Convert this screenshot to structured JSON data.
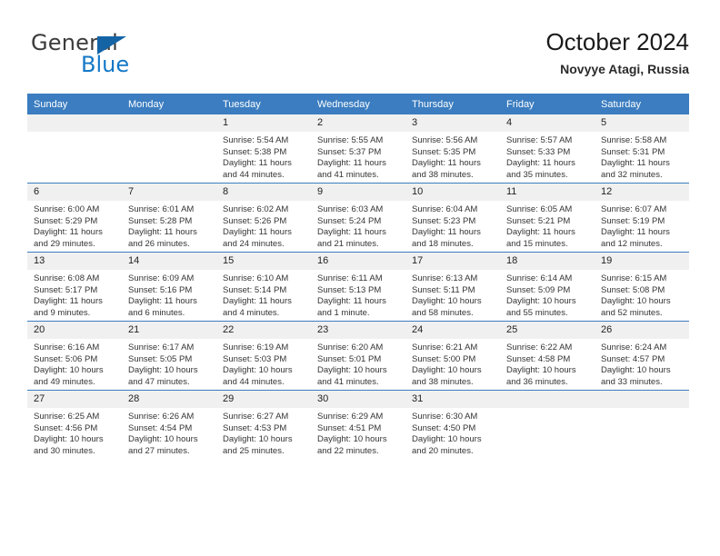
{
  "brand": {
    "name_top": "General",
    "name_bottom": "Blue",
    "flag_color": "#1464a5",
    "blue_color": "#1478c8"
  },
  "header": {
    "title": "October 2024",
    "subtitle": "Novyye Atagi, Russia"
  },
  "theme": {
    "header_row_bg": "#3b7dc0",
    "daynum_bg": "#f0f0f0",
    "text": "#343434"
  },
  "weekday_headers": [
    "Sunday",
    "Monday",
    "Tuesday",
    "Wednesday",
    "Thursday",
    "Friday",
    "Saturday"
  ],
  "weeks": [
    [
      {
        "day": "",
        "lines": []
      },
      {
        "day": "",
        "lines": []
      },
      {
        "day": "1",
        "lines": [
          "Sunrise: 5:54 AM",
          "Sunset: 5:38 PM",
          "Daylight: 11 hours",
          "and 44 minutes."
        ]
      },
      {
        "day": "2",
        "lines": [
          "Sunrise: 5:55 AM",
          "Sunset: 5:37 PM",
          "Daylight: 11 hours",
          "and 41 minutes."
        ]
      },
      {
        "day": "3",
        "lines": [
          "Sunrise: 5:56 AM",
          "Sunset: 5:35 PM",
          "Daylight: 11 hours",
          "and 38 minutes."
        ]
      },
      {
        "day": "4",
        "lines": [
          "Sunrise: 5:57 AM",
          "Sunset: 5:33 PM",
          "Daylight: 11 hours",
          "and 35 minutes."
        ]
      },
      {
        "day": "5",
        "lines": [
          "Sunrise: 5:58 AM",
          "Sunset: 5:31 PM",
          "Daylight: 11 hours",
          "and 32 minutes."
        ]
      }
    ],
    [
      {
        "day": "6",
        "lines": [
          "Sunrise: 6:00 AM",
          "Sunset: 5:29 PM",
          "Daylight: 11 hours",
          "and 29 minutes."
        ]
      },
      {
        "day": "7",
        "lines": [
          "Sunrise: 6:01 AM",
          "Sunset: 5:28 PM",
          "Daylight: 11 hours",
          "and 26 minutes."
        ]
      },
      {
        "day": "8",
        "lines": [
          "Sunrise: 6:02 AM",
          "Sunset: 5:26 PM",
          "Daylight: 11 hours",
          "and 24 minutes."
        ]
      },
      {
        "day": "9",
        "lines": [
          "Sunrise: 6:03 AM",
          "Sunset: 5:24 PM",
          "Daylight: 11 hours",
          "and 21 minutes."
        ]
      },
      {
        "day": "10",
        "lines": [
          "Sunrise: 6:04 AM",
          "Sunset: 5:23 PM",
          "Daylight: 11 hours",
          "and 18 minutes."
        ]
      },
      {
        "day": "11",
        "lines": [
          "Sunrise: 6:05 AM",
          "Sunset: 5:21 PM",
          "Daylight: 11 hours",
          "and 15 minutes."
        ]
      },
      {
        "day": "12",
        "lines": [
          "Sunrise: 6:07 AM",
          "Sunset: 5:19 PM",
          "Daylight: 11 hours",
          "and 12 minutes."
        ]
      }
    ],
    [
      {
        "day": "13",
        "lines": [
          "Sunrise: 6:08 AM",
          "Sunset: 5:17 PM",
          "Daylight: 11 hours",
          "and 9 minutes."
        ]
      },
      {
        "day": "14",
        "lines": [
          "Sunrise: 6:09 AM",
          "Sunset: 5:16 PM",
          "Daylight: 11 hours",
          "and 6 minutes."
        ]
      },
      {
        "day": "15",
        "lines": [
          "Sunrise: 6:10 AM",
          "Sunset: 5:14 PM",
          "Daylight: 11 hours",
          "and 4 minutes."
        ]
      },
      {
        "day": "16",
        "lines": [
          "Sunrise: 6:11 AM",
          "Sunset: 5:13 PM",
          "Daylight: 11 hours",
          "and 1 minute."
        ]
      },
      {
        "day": "17",
        "lines": [
          "Sunrise: 6:13 AM",
          "Sunset: 5:11 PM",
          "Daylight: 10 hours",
          "and 58 minutes."
        ]
      },
      {
        "day": "18",
        "lines": [
          "Sunrise: 6:14 AM",
          "Sunset: 5:09 PM",
          "Daylight: 10 hours",
          "and 55 minutes."
        ]
      },
      {
        "day": "19",
        "lines": [
          "Sunrise: 6:15 AM",
          "Sunset: 5:08 PM",
          "Daylight: 10 hours",
          "and 52 minutes."
        ]
      }
    ],
    [
      {
        "day": "20",
        "lines": [
          "Sunrise: 6:16 AM",
          "Sunset: 5:06 PM",
          "Daylight: 10 hours",
          "and 49 minutes."
        ]
      },
      {
        "day": "21",
        "lines": [
          "Sunrise: 6:17 AM",
          "Sunset: 5:05 PM",
          "Daylight: 10 hours",
          "and 47 minutes."
        ]
      },
      {
        "day": "22",
        "lines": [
          "Sunrise: 6:19 AM",
          "Sunset: 5:03 PM",
          "Daylight: 10 hours",
          "and 44 minutes."
        ]
      },
      {
        "day": "23",
        "lines": [
          "Sunrise: 6:20 AM",
          "Sunset: 5:01 PM",
          "Daylight: 10 hours",
          "and 41 minutes."
        ]
      },
      {
        "day": "24",
        "lines": [
          "Sunrise: 6:21 AM",
          "Sunset: 5:00 PM",
          "Daylight: 10 hours",
          "and 38 minutes."
        ]
      },
      {
        "day": "25",
        "lines": [
          "Sunrise: 6:22 AM",
          "Sunset: 4:58 PM",
          "Daylight: 10 hours",
          "and 36 minutes."
        ]
      },
      {
        "day": "26",
        "lines": [
          "Sunrise: 6:24 AM",
          "Sunset: 4:57 PM",
          "Daylight: 10 hours",
          "and 33 minutes."
        ]
      }
    ],
    [
      {
        "day": "27",
        "lines": [
          "Sunrise: 6:25 AM",
          "Sunset: 4:56 PM",
          "Daylight: 10 hours",
          "and 30 minutes."
        ]
      },
      {
        "day": "28",
        "lines": [
          "Sunrise: 6:26 AM",
          "Sunset: 4:54 PM",
          "Daylight: 10 hours",
          "and 27 minutes."
        ]
      },
      {
        "day": "29",
        "lines": [
          "Sunrise: 6:27 AM",
          "Sunset: 4:53 PM",
          "Daylight: 10 hours",
          "and 25 minutes."
        ]
      },
      {
        "day": "30",
        "lines": [
          "Sunrise: 6:29 AM",
          "Sunset: 4:51 PM",
          "Daylight: 10 hours",
          "and 22 minutes."
        ]
      },
      {
        "day": "31",
        "lines": [
          "Sunrise: 6:30 AM",
          "Sunset: 4:50 PM",
          "Daylight: 10 hours",
          "and 20 minutes."
        ]
      },
      {
        "day": "",
        "lines": []
      },
      {
        "day": "",
        "lines": []
      }
    ]
  ]
}
